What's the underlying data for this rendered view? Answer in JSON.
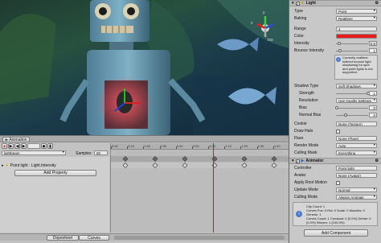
{
  "scene": {
    "iso_label": "Iso",
    "axis_y": "y",
    "axis_x": "x"
  },
  "animation": {
    "tab_title": "Animation",
    "clip_name": "lightbeam",
    "samples_label": "Samples",
    "samples_value": "60",
    "property_label": "Point light : Light.Intensity",
    "add_property_label": "Add Property",
    "ruler_labels": [
      "0:00",
      "0:10",
      "0:20",
      "0:30",
      "0:40",
      "0:50",
      "1:00",
      "1:10",
      "1:20",
      "1:30",
      "1:40"
    ],
    "view_tabs": [
      "Dopesheet",
      "Curves"
    ],
    "playhead_time": "1:05"
  },
  "inspector": {
    "light_header": "Light",
    "type_label": "Type",
    "type_value": "Point",
    "baking_label": "Baking",
    "baking_value": "Realtime",
    "range_label": "Range",
    "range_value": "4",
    "color_label": "Color",
    "color_value": "#e81c1c",
    "intensity_label": "Intensity",
    "intensity_value": "0.8",
    "intensity_fraction": 0.1,
    "bounce_label": "Bounce Intensity",
    "bounce_value": "1",
    "bounce_fraction": 0.125,
    "warning_text": "Currently realtime indirect bounce light shadowing for spot and point lights is not supported.",
    "shadow_type_label": "Shadow Type",
    "shadow_type_value": "Soft Shadows",
    "strength_label": "Strength",
    "strength_value": "1",
    "strength_fraction": 1.0,
    "resolution_label": "Resolution",
    "resolution_value": "Use Quality Settings",
    "bias_label": "Bias",
    "bias_value": "0",
    "bias_fraction": 0.02,
    "normal_bias_label": "Normal Bias",
    "normal_bias_value": "0",
    "normal_bias_fraction": 0.3,
    "cookie_label": "Cookie",
    "cookie_value": "None (Texture)",
    "draw_halo_label": "Draw Halo",
    "flare_label": "Flare",
    "flare_value": "None (Flare)",
    "render_mode_label": "Render Mode",
    "render_mode_value": "Auto",
    "culling_mask_label": "Culling Mask",
    "culling_mask_value": "Everything",
    "animator_header": "Animator",
    "controller_label": "Controller",
    "controller_value": "Point light",
    "avatar_label": "Avatar",
    "avatar_value": "None (Avatar)",
    "apply_root_label": "Apply Root Motion",
    "update_mode_label": "Update Mode",
    "update_mode_value": "Normal",
    "culling_mode_label": "Culling Mode",
    "culling_mode_value": "Always Animate",
    "info_lines": [
      "Clip Count: 1",
      "Curves Pos: 0 Rot: 0 Scale: 0 Muscles: 0 Generic: 1",
      "Curves Count: 1 Constant: 0 (0.0%) Dense: 0",
      "(0.0%) Stream: 1 (100.0%)"
    ],
    "add_component_label": "Add Component"
  }
}
